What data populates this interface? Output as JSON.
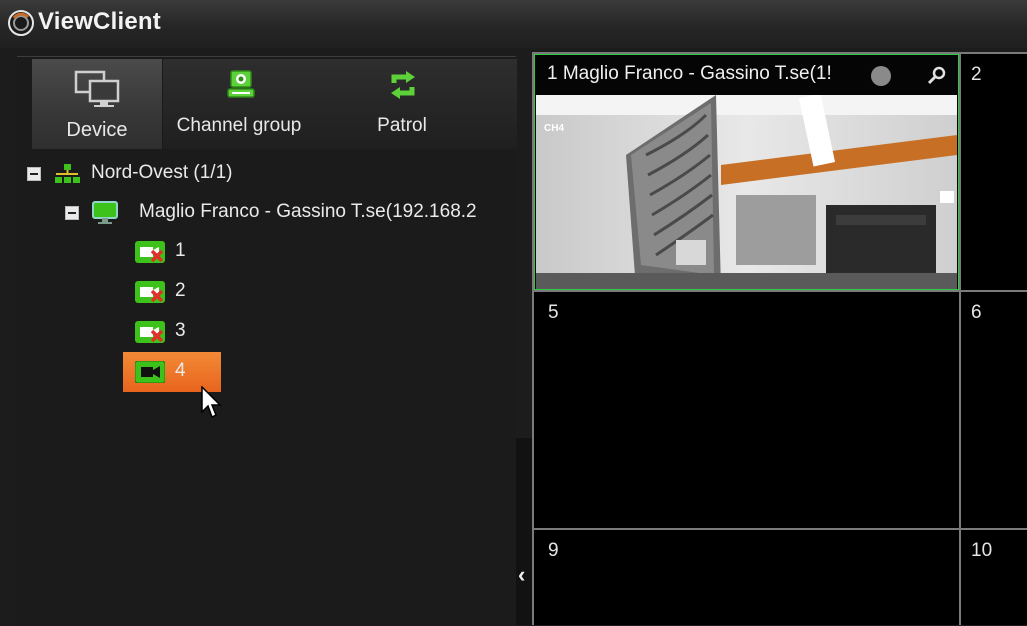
{
  "app": {
    "title": "ViewClient"
  },
  "tabs": [
    {
      "label": "Device",
      "icon": "monitor-icon"
    },
    {
      "label": "Channel group",
      "icon": "channel-group-icon"
    },
    {
      "label": "Patrol",
      "icon": "refresh-icon"
    }
  ],
  "tree": {
    "region": {
      "label": "Nord-Ovest (1/1)",
      "icon": "network-icon"
    },
    "device": {
      "label": "Maglio Franco - Gassino T.se(192.168.2",
      "icon": "monitor-icon"
    },
    "channels": [
      {
        "label": "1",
        "status": "offline"
      },
      {
        "label": "2",
        "status": "offline"
      },
      {
        "label": "3",
        "status": "offline"
      },
      {
        "label": "4",
        "status": "selected"
      }
    ]
  },
  "video_grid": {
    "cell_1": {
      "number": "1",
      "title": "1 Maglio Franco - Gassino T.se(1!",
      "osd": "CH4"
    },
    "cell_2": {
      "number": "2"
    },
    "cell_5": {
      "number": "5"
    },
    "cell_6": {
      "number": "6"
    },
    "cell_9": {
      "number": "9"
    },
    "cell_10": {
      "number": "10"
    }
  },
  "colors": {
    "selected_highlight": "#f07a2a",
    "active_border": "#2ecc40",
    "icon_green": "#3dc21b"
  }
}
